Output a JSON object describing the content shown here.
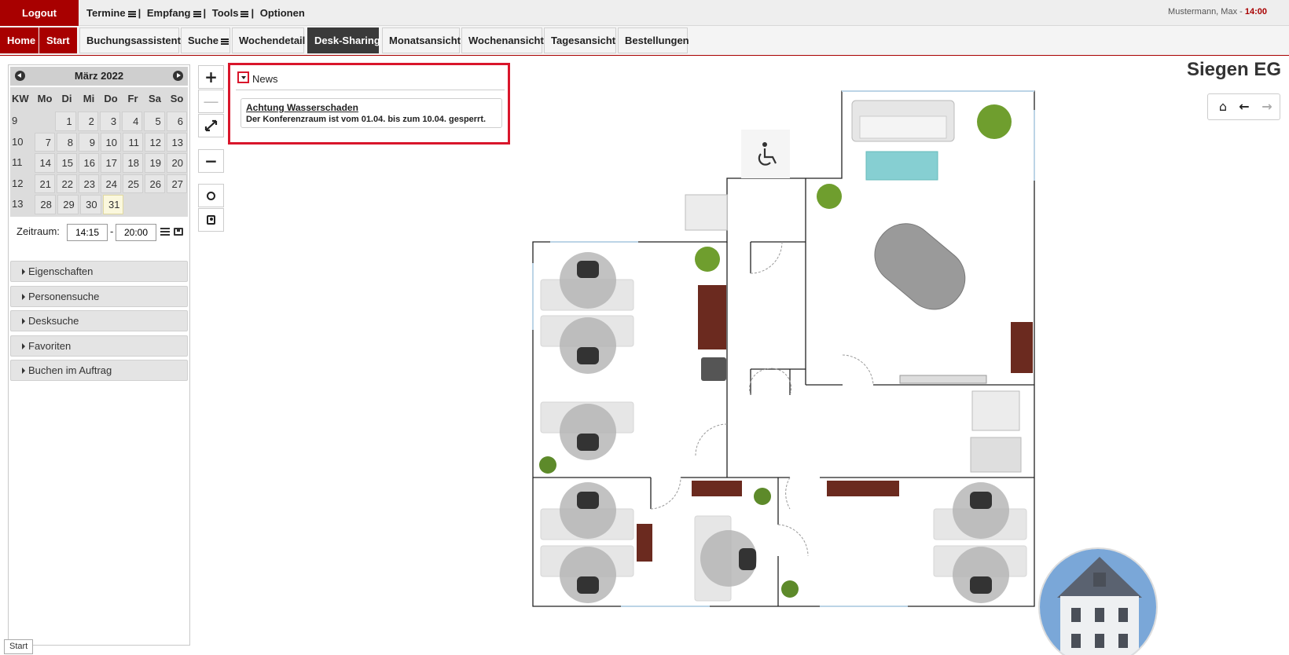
{
  "topbar": {
    "logout": "Logout",
    "menu": [
      "Termine",
      "Empfang",
      "Tools"
    ],
    "options": "Optionen",
    "user": "Mustermann, Max - ",
    "time": "14:00"
  },
  "nav": {
    "home": "Home",
    "start": "Start",
    "booking_assistant": "Buchungsassistent",
    "search": "Suche",
    "week_detail": "Wochendetail",
    "desk_sharing": "Desk-Sharing",
    "month_view": "Monatsansicht",
    "week_view": "Wochenansicht",
    "day_view": "Tagesansicht",
    "orders": "Bestellungen"
  },
  "calendar": {
    "month": "März 2022",
    "headers": [
      "KW",
      "Mo",
      "Di",
      "Mi",
      "Do",
      "Fr",
      "Sa",
      "So"
    ],
    "weeks": [
      {
        "kw": "9",
        "days": [
          "",
          "1",
          "2",
          "3",
          "4",
          "5",
          "6"
        ]
      },
      {
        "kw": "10",
        "days": [
          "7",
          "8",
          "9",
          "10",
          "11",
          "12",
          "13"
        ]
      },
      {
        "kw": "11",
        "days": [
          "14",
          "15",
          "16",
          "17",
          "18",
          "19",
          "20"
        ]
      },
      {
        "kw": "12",
        "days": [
          "21",
          "22",
          "23",
          "24",
          "25",
          "26",
          "27"
        ]
      },
      {
        "kw": "13",
        "days": [
          "28",
          "29",
          "30",
          "31",
          "",
          "",
          ""
        ]
      }
    ],
    "today": "31"
  },
  "zeitraum": {
    "label": "Zeitraum:",
    "from": "14:15",
    "dash": "-",
    "to": "20:00"
  },
  "accordion": [
    "Eigenschaften",
    "Personensuche",
    "Desksuche",
    "Favoriten",
    "Buchen im Auftrag"
  ],
  "zoom": {
    "plus": "+",
    "line": "—",
    "minus": "−"
  },
  "news": {
    "title": "News",
    "item_title": "Achtung Wasserschaden",
    "item_text": "Der Konferenzraum ist vom 01.04. bis zum 10.04. gesperrt."
  },
  "building": "Siegen EG",
  "status_tab": "Start",
  "colors": {
    "brand": "#a80000",
    "news_border": "#d9162b",
    "active_nav": "#3a3a3a"
  }
}
